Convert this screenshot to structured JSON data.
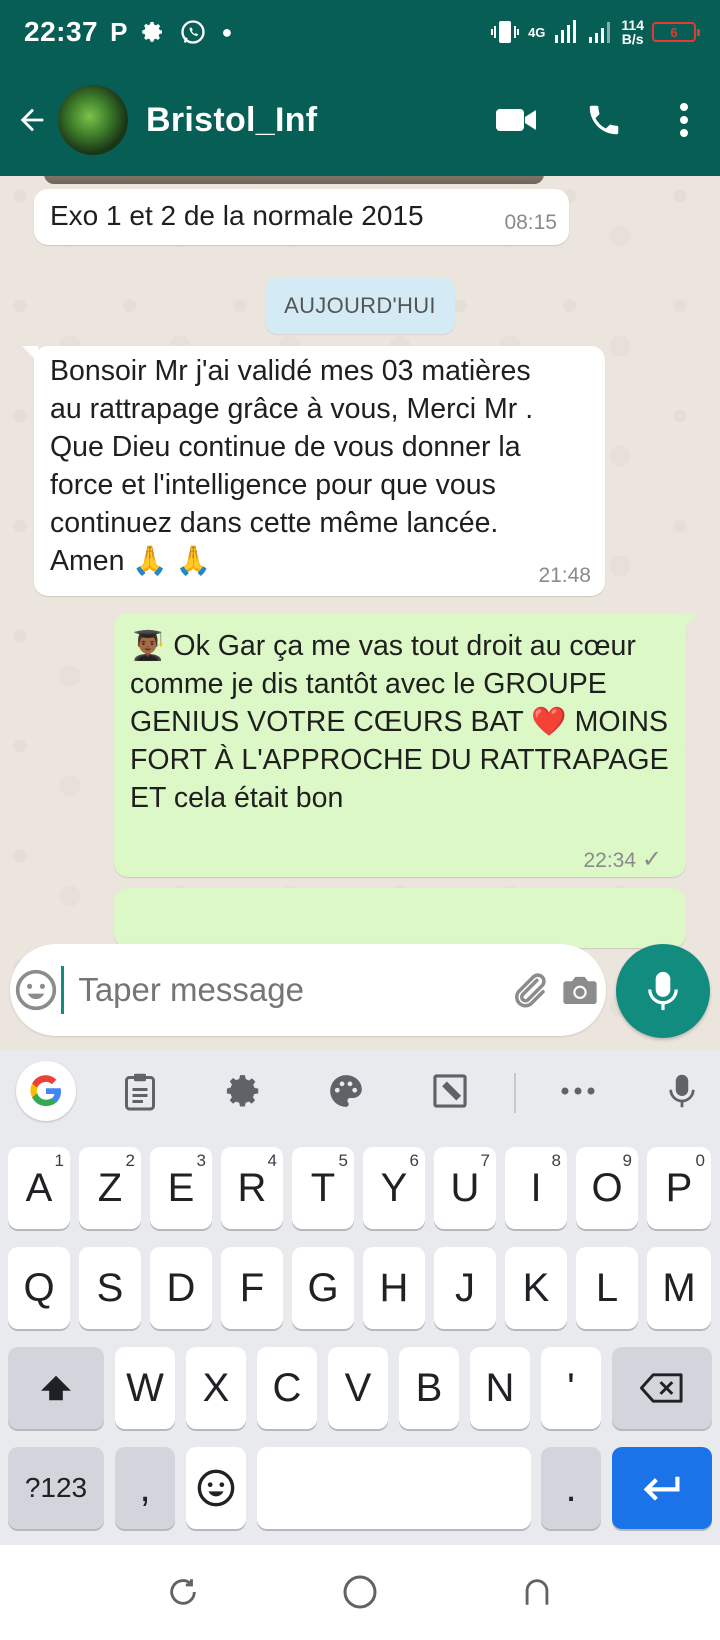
{
  "status_bar": {
    "time": "22:37",
    "left_icons": [
      "parking-icon",
      "gear-icon",
      "whatsapp-icon",
      "dot-icon"
    ],
    "network": "4G",
    "speed_value": "114",
    "speed_unit": "B/s",
    "battery": "6",
    "battery_color": "#e53935"
  },
  "app_bar": {
    "title": "Bristol_Inf",
    "color": "#075e54"
  },
  "messages": [
    {
      "direction": "in",
      "text": "Exo 1 et 2 de la normale 2015",
      "time": "08:15"
    },
    {
      "direction": "in",
      "text": "Bonsoir Mr j'ai validé mes 03 matières au rattrapage grâce à vous, Merci Mr . Que Dieu continue de vous donner la force et l'intelligence pour que vous continuez dans cette même lancée. Amen 🙏 🙏",
      "time": "21:48"
    },
    {
      "direction": "out",
      "text": "👨🏾‍🎓 Ok Gar ça me vas tout droit au cœur comme je dis tantôt avec le GROUPE GENIUS VOTRE CŒURS BAT ❤️ MOINS FORT À L'APPROCHE DU RATTRAPAGE ET cela était bon",
      "time": "22:34",
      "status": "✓"
    }
  ],
  "date_chip": "AUJOURD'HUI",
  "composer": {
    "placeholder": "Taper message"
  },
  "keyboard": {
    "row1": [
      {
        "label": "A",
        "hint": "1"
      },
      {
        "label": "Z",
        "hint": "2"
      },
      {
        "label": "E",
        "hint": "3"
      },
      {
        "label": "R",
        "hint": "4"
      },
      {
        "label": "T",
        "hint": "5"
      },
      {
        "label": "Y",
        "hint": "6"
      },
      {
        "label": "U",
        "hint": "7"
      },
      {
        "label": "I",
        "hint": "8"
      },
      {
        "label": "O",
        "hint": "9"
      },
      {
        "label": "P",
        "hint": "0"
      }
    ],
    "row2": [
      "Q",
      "S",
      "D",
      "F",
      "G",
      "H",
      "J",
      "K",
      "L",
      "M"
    ],
    "row3": [
      "W",
      "X",
      "C",
      "V",
      "B",
      "N",
      "'"
    ],
    "symbols_key": "?123",
    "comma_key": ",",
    "period_key": ".",
    "accent_color": "#1a73e8"
  }
}
